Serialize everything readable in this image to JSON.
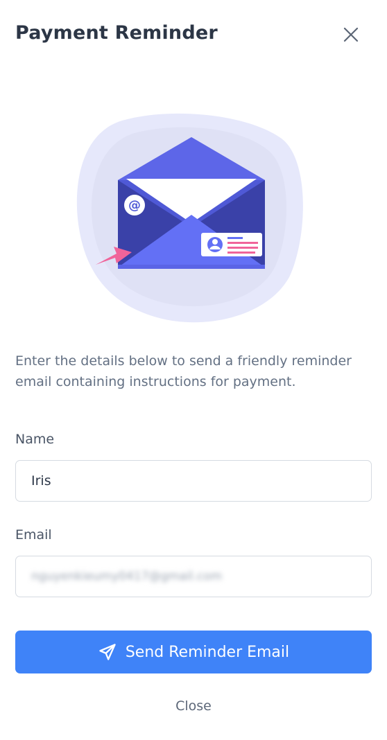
{
  "dialog": {
    "title": "Payment Reminder",
    "description": "Enter the details below to send a friendly reminder email containing instructions for payment."
  },
  "form": {
    "name_label": "Name",
    "name_value": "Iris",
    "email_label": "Email",
    "email_value": "nguyenkieumy0417@gmail.com"
  },
  "actions": {
    "send_label": "Send Reminder Email",
    "close_label": "Close"
  },
  "icons": {
    "close": "close-icon",
    "send": "paper-plane-icon",
    "illustration": "envelope-illustration"
  },
  "colors": {
    "primary": "#3f83f8",
    "envelope": "#4f59d6",
    "accent_pink": "#f0649a"
  }
}
